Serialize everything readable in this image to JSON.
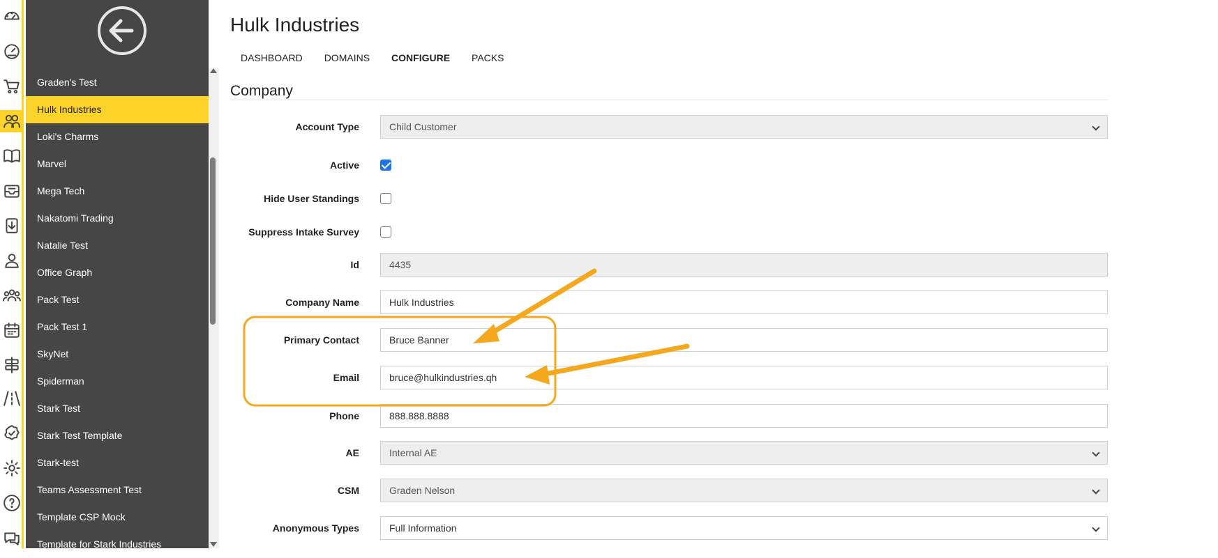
{
  "rail": {
    "icons": [
      "dashboard-gauge-icon",
      "speedometer-icon",
      "cart-icon",
      "users-icon",
      "book-icon",
      "inbox-icon",
      "download-doc-icon",
      "user-icon",
      "team-icon",
      "calendar-icon",
      "signpost-icon",
      "road-icon",
      "badge-check-icon",
      "gear-icon",
      "help-icon",
      "chat-icon"
    ],
    "active_index": 3
  },
  "sidebar": {
    "items": [
      "Graden's Test",
      "Hulk Industries",
      "Loki's Charms",
      "Marvel",
      "Mega Tech",
      "Nakatomi Trading",
      "Natalie Test",
      "Office Graph",
      "Pack Test",
      "Pack Test 1",
      "SkyNet",
      "Spiderman",
      "Stark Test",
      "Stark Test Template",
      "Stark-test",
      "Teams Assessment Test",
      "Template CSP Mock",
      "Template for Stark Industries"
    ],
    "selected": "Hulk Industries"
  },
  "header": {
    "title": "Hulk Industries",
    "tabs": [
      "DASHBOARD",
      "DOMAINS",
      "CONFIGURE",
      "PACKS"
    ],
    "active_tab": "CONFIGURE"
  },
  "section": {
    "title": "Company"
  },
  "form": {
    "account_type": {
      "label": "Account Type",
      "value": "Child Customer"
    },
    "active": {
      "label": "Active",
      "checked": true
    },
    "hide_user_standings": {
      "label": "Hide User Standings",
      "checked": false
    },
    "suppress_intake_survey": {
      "label": "Suppress Intake Survey",
      "checked": false
    },
    "id": {
      "label": "Id",
      "value": "4435"
    },
    "company_name": {
      "label": "Company Name",
      "value": "Hulk Industries"
    },
    "primary_contact": {
      "label": "Primary Contact",
      "value": "Bruce Banner"
    },
    "email": {
      "label": "Email",
      "value": "bruce@hulkindustries.qh"
    },
    "phone": {
      "label": "Phone",
      "value": "888.888.8888"
    },
    "ae": {
      "label": "AE",
      "value": "Internal AE"
    },
    "csm": {
      "label": "CSM",
      "value": "Graden Nelson"
    },
    "anonymous_types": {
      "label": "Anonymous Types",
      "value": "Full Information"
    }
  },
  "colors": {
    "accent": "#fdd32a",
    "sidebar_bg": "#464646",
    "annotation": "#f5a81d"
  }
}
